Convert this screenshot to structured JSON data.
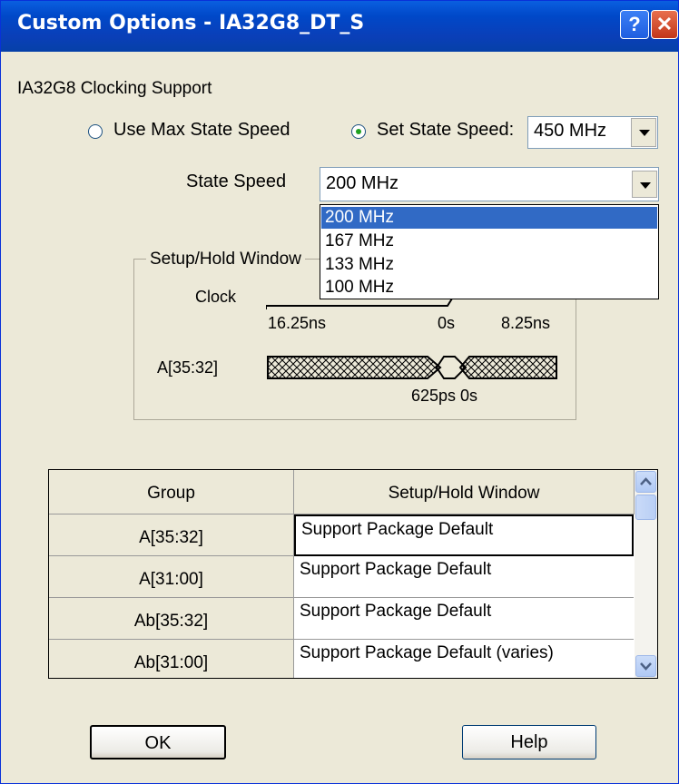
{
  "window": {
    "title": "Custom Options - IA32G8_DT_S",
    "help_glyph": "?",
    "close_glyph": "✕"
  },
  "clocking": {
    "section_label": "IA32G8 Clocking Support",
    "radio_max": {
      "label": "Use Max State Speed",
      "selected": false
    },
    "radio_set": {
      "label": "Set State Speed:",
      "selected": true
    },
    "set_speed_value": "450 MHz",
    "state_speed_label": "State Speed",
    "state_speed_value": "200 MHz",
    "state_speed_options": [
      "200 MHz",
      "167 MHz",
      "133 MHz",
      "100 MHz"
    ],
    "state_speed_selected_index": 0
  },
  "setup_hold": {
    "group_label": "Setup/Hold Window",
    "clock_label": "Clock",
    "clock_left_time": "16.25ns",
    "clock_mid_time": "0s",
    "clock_right_time": "8.25ns",
    "signal_label": "A[35:32]",
    "signal_times": "625ps 0s"
  },
  "grid": {
    "columns": [
      "Group",
      "Setup/Hold Window"
    ],
    "rows": [
      {
        "group": "A[35:32]",
        "window": "Support Package Default"
      },
      {
        "group": "A[31:00]",
        "window": "Support Package Default"
      },
      {
        "group": "Ab[35:32]",
        "window": "Support Package Default"
      },
      {
        "group": "Ab[31:00]",
        "window": "Support Package Default (varies)"
      }
    ]
  },
  "buttons": {
    "ok": "OK",
    "help": "Help"
  }
}
